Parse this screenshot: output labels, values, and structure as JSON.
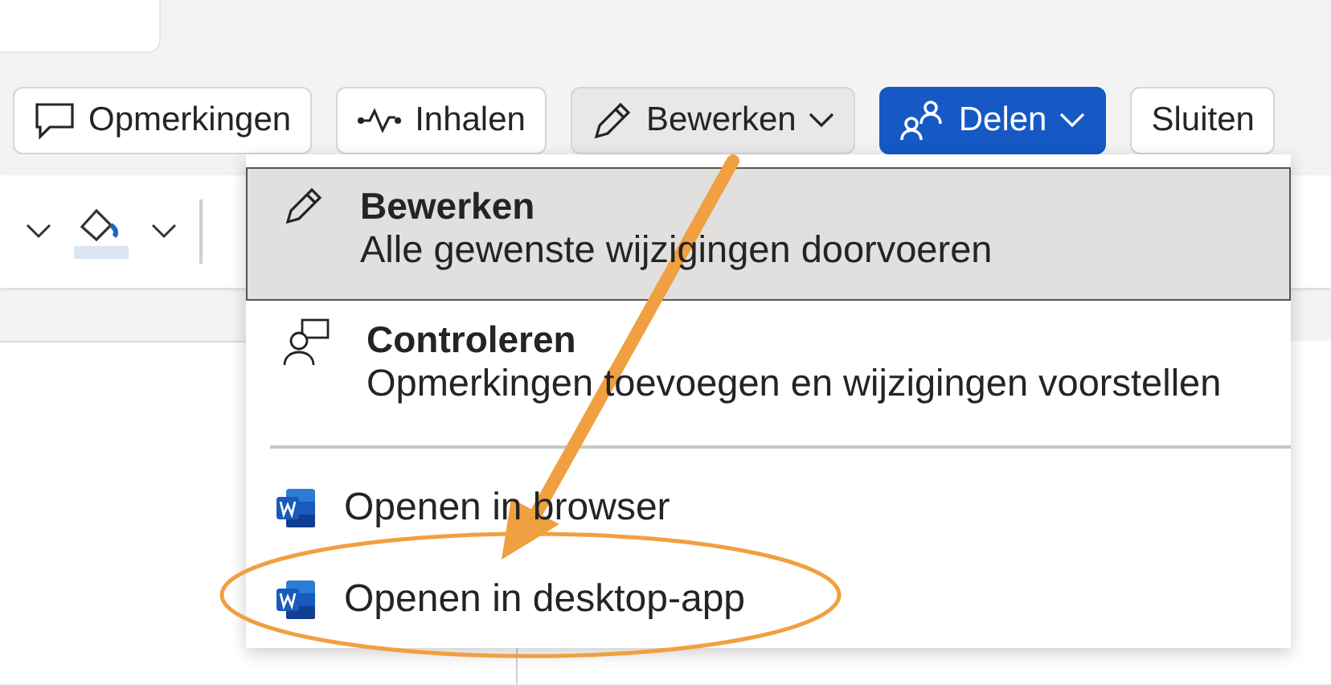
{
  "toolbar": [
    {
      "label": "Opmerkingen",
      "kind": "default",
      "pressed": false,
      "caret": false
    },
    {
      "label": "Inhalen",
      "kind": "default",
      "pressed": false,
      "caret": false
    },
    {
      "label": "Bewerken",
      "kind": "default",
      "pressed": true,
      "caret": true
    },
    {
      "label": "Delen",
      "kind": "primary",
      "pressed": false,
      "caret": true
    },
    {
      "label": "Sluiten",
      "kind": "default",
      "pressed": false,
      "caret": false
    }
  ],
  "menu": {
    "items": [
      {
        "kind": "mode",
        "title": "Bewerken",
        "description": "Alle gewenste wijzigingen doorvoeren",
        "selected": true
      },
      {
        "kind": "mode",
        "title": "Controleren",
        "description": "Opmerkingen toevoegen en wijzigingen voorstellen",
        "selected": false
      },
      {
        "kind": "divider"
      },
      {
        "kind": "app",
        "label": "Openen in browser"
      },
      {
        "kind": "app",
        "label": "Openen in desktop-app"
      }
    ]
  },
  "annotations": {
    "arrow": true,
    "ellipse": true
  }
}
